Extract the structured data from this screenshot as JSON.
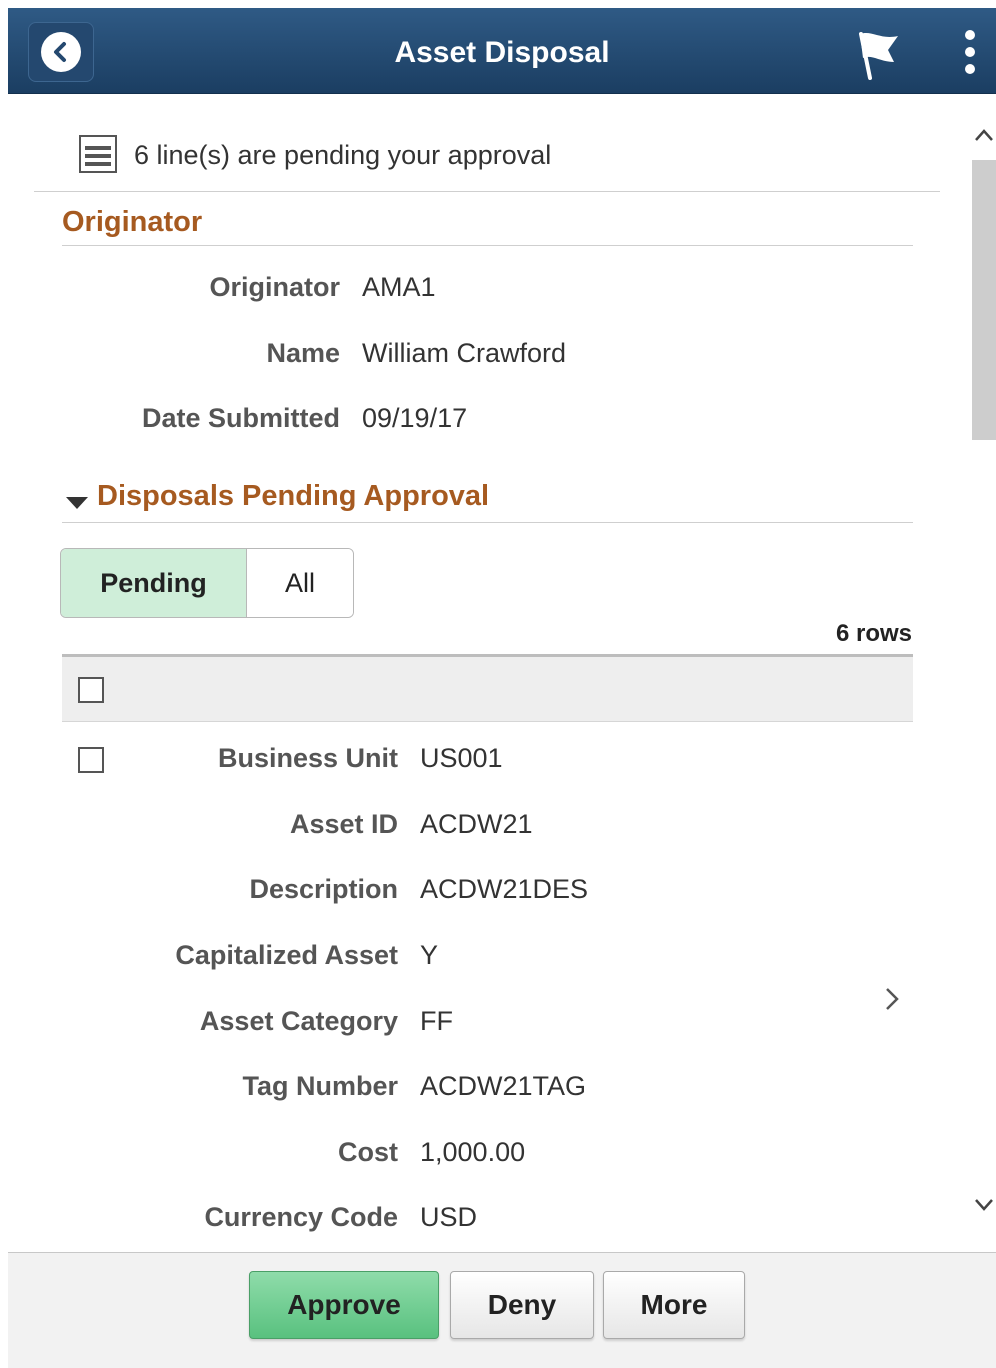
{
  "header": {
    "title": "Asset Disposal",
    "back_icon": "chevron-left-icon",
    "flag_icon": "flag-icon",
    "menu_icon": "kebab-menu-icon"
  },
  "banner": {
    "text": "6 line(s) are pending your approval",
    "icon": "list-icon"
  },
  "originator_section": {
    "title": "Originator",
    "fields": [
      {
        "label": "Originator",
        "value": "AMA1"
      },
      {
        "label": "Name",
        "value": "William Crawford"
      },
      {
        "label": "Date Submitted",
        "value": "09/19/17"
      }
    ]
  },
  "disposals_section": {
    "title": "Disposals Pending Approval",
    "tabs": [
      {
        "label": "Pending",
        "active": true
      },
      {
        "label": "All",
        "active": false
      }
    ],
    "row_count": "6 rows",
    "rows": [
      {
        "fields": [
          {
            "label": "Business Unit",
            "value": "US001"
          },
          {
            "label": "Asset ID",
            "value": "ACDW21"
          },
          {
            "label": "Description",
            "value": "ACDW21DES"
          },
          {
            "label": "Capitalized Asset",
            "value": "Y"
          },
          {
            "label": "Asset Category",
            "value": "FF"
          },
          {
            "label": "Tag Number",
            "value": "ACDW21TAG"
          },
          {
            "label": "Cost",
            "value": "1,000.00"
          },
          {
            "label": "Currency Code",
            "value": "USD"
          }
        ]
      }
    ]
  },
  "footer": {
    "approve_label": "Approve",
    "deny_label": "Deny",
    "more_label": "More"
  },
  "colors": {
    "header_bg": "#1b3e62",
    "section_title": "#a65a20",
    "active_tab": "#cfeed9",
    "approve_button": "#59c17f"
  }
}
